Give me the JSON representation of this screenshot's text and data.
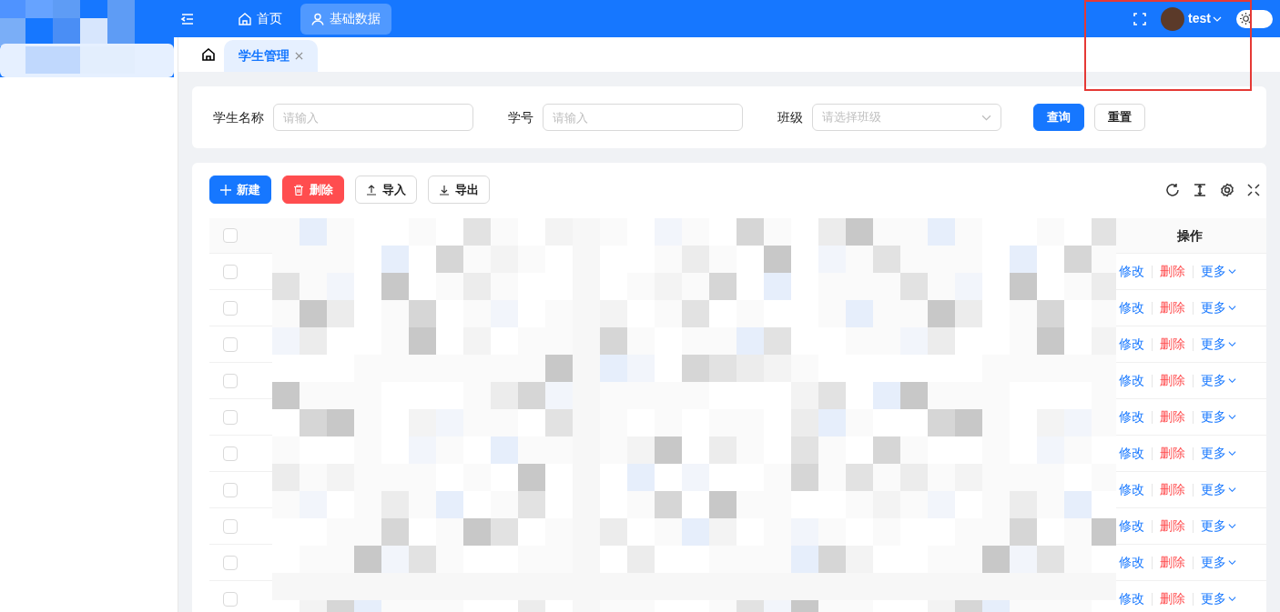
{
  "header": {
    "nav": [
      {
        "label": "首页",
        "selected": false
      },
      {
        "label": "基础数据",
        "selected": true
      }
    ],
    "user": "test",
    "dark_mode": false
  },
  "tabs": [
    {
      "label": "学生管理",
      "selected": true
    }
  ],
  "search": {
    "fields": [
      {
        "kind": "input",
        "label": "学生名称",
        "placeholder": "请输入"
      },
      {
        "kind": "input",
        "label": "学号",
        "placeholder": "请输入"
      },
      {
        "kind": "select",
        "label": "班级",
        "placeholder": "请选择班级"
      }
    ],
    "buttons": [
      {
        "label": "查询",
        "kind": "primary"
      },
      {
        "label": "重置",
        "kind": "default"
      }
    ]
  },
  "toolbar": [
    {
      "label": "新建",
      "kind": "primary"
    },
    {
      "label": "删除",
      "kind": "danger"
    },
    {
      "label": "导入",
      "kind": "default"
    },
    {
      "label": "导出",
      "kind": "default"
    }
  ],
  "table": {
    "action_column": "操作",
    "all_checked": false,
    "rows": [
      {
        "checked": false,
        "actions": [
          "修改",
          "删除",
          "更多"
        ]
      },
      {
        "checked": false,
        "actions": [
          "修改",
          "删除",
          "更多"
        ]
      },
      {
        "checked": false,
        "actions": [
          "修改",
          "删除",
          "更多"
        ]
      },
      {
        "checked": false,
        "actions": [
          "修改",
          "删除",
          "更多"
        ]
      },
      {
        "checked": false,
        "actions": [
          "修改",
          "删除",
          "更多"
        ]
      },
      {
        "checked": false,
        "actions": [
          "修改",
          "删除",
          "更多"
        ]
      },
      {
        "checked": false,
        "actions": [
          "修改",
          "删除",
          "更多"
        ]
      },
      {
        "checked": false,
        "actions": [
          "修改",
          "删除",
          "更多"
        ]
      },
      {
        "checked": false,
        "actions": [
          "修改",
          "删除",
          "更多"
        ]
      },
      {
        "checked": false,
        "actions": [
          "修改",
          "删除",
          "更多"
        ]
      }
    ]
  }
}
